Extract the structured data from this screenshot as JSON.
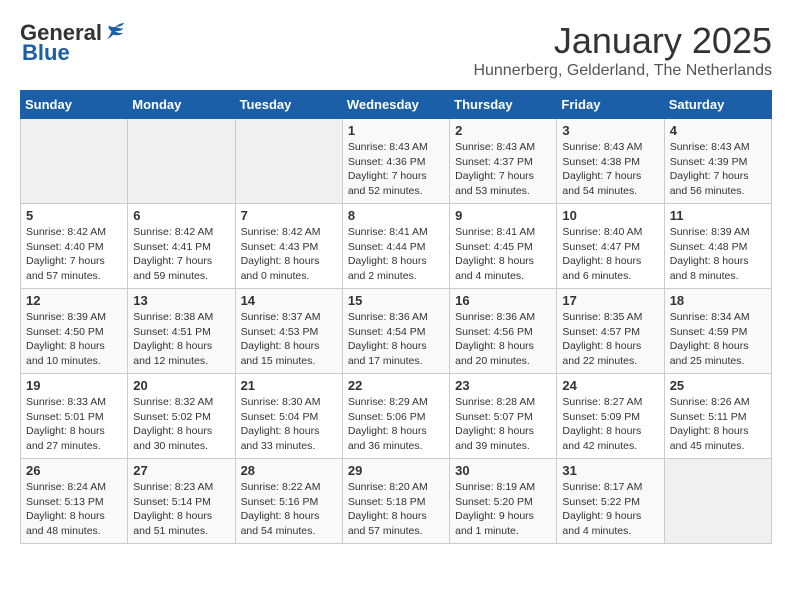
{
  "header": {
    "logo_general": "General",
    "logo_blue": "Blue",
    "month": "January 2025",
    "location": "Hunnerberg, Gelderland, The Netherlands"
  },
  "weekdays": [
    "Sunday",
    "Monday",
    "Tuesday",
    "Wednesday",
    "Thursday",
    "Friday",
    "Saturday"
  ],
  "weeks": [
    [
      {
        "day": "",
        "info": ""
      },
      {
        "day": "",
        "info": ""
      },
      {
        "day": "",
        "info": ""
      },
      {
        "day": "1",
        "info": "Sunrise: 8:43 AM\nSunset: 4:36 PM\nDaylight: 7 hours\nand 52 minutes."
      },
      {
        "day": "2",
        "info": "Sunrise: 8:43 AM\nSunset: 4:37 PM\nDaylight: 7 hours\nand 53 minutes."
      },
      {
        "day": "3",
        "info": "Sunrise: 8:43 AM\nSunset: 4:38 PM\nDaylight: 7 hours\nand 54 minutes."
      },
      {
        "day": "4",
        "info": "Sunrise: 8:43 AM\nSunset: 4:39 PM\nDaylight: 7 hours\nand 56 minutes."
      }
    ],
    [
      {
        "day": "5",
        "info": "Sunrise: 8:42 AM\nSunset: 4:40 PM\nDaylight: 7 hours\nand 57 minutes."
      },
      {
        "day": "6",
        "info": "Sunrise: 8:42 AM\nSunset: 4:41 PM\nDaylight: 7 hours\nand 59 minutes."
      },
      {
        "day": "7",
        "info": "Sunrise: 8:42 AM\nSunset: 4:43 PM\nDaylight: 8 hours\nand 0 minutes."
      },
      {
        "day": "8",
        "info": "Sunrise: 8:41 AM\nSunset: 4:44 PM\nDaylight: 8 hours\nand 2 minutes."
      },
      {
        "day": "9",
        "info": "Sunrise: 8:41 AM\nSunset: 4:45 PM\nDaylight: 8 hours\nand 4 minutes."
      },
      {
        "day": "10",
        "info": "Sunrise: 8:40 AM\nSunset: 4:47 PM\nDaylight: 8 hours\nand 6 minutes."
      },
      {
        "day": "11",
        "info": "Sunrise: 8:39 AM\nSunset: 4:48 PM\nDaylight: 8 hours\nand 8 minutes."
      }
    ],
    [
      {
        "day": "12",
        "info": "Sunrise: 8:39 AM\nSunset: 4:50 PM\nDaylight: 8 hours\nand 10 minutes."
      },
      {
        "day": "13",
        "info": "Sunrise: 8:38 AM\nSunset: 4:51 PM\nDaylight: 8 hours\nand 12 minutes."
      },
      {
        "day": "14",
        "info": "Sunrise: 8:37 AM\nSunset: 4:53 PM\nDaylight: 8 hours\nand 15 minutes."
      },
      {
        "day": "15",
        "info": "Sunrise: 8:36 AM\nSunset: 4:54 PM\nDaylight: 8 hours\nand 17 minutes."
      },
      {
        "day": "16",
        "info": "Sunrise: 8:36 AM\nSunset: 4:56 PM\nDaylight: 8 hours\nand 20 minutes."
      },
      {
        "day": "17",
        "info": "Sunrise: 8:35 AM\nSunset: 4:57 PM\nDaylight: 8 hours\nand 22 minutes."
      },
      {
        "day": "18",
        "info": "Sunrise: 8:34 AM\nSunset: 4:59 PM\nDaylight: 8 hours\nand 25 minutes."
      }
    ],
    [
      {
        "day": "19",
        "info": "Sunrise: 8:33 AM\nSunset: 5:01 PM\nDaylight: 8 hours\nand 27 minutes."
      },
      {
        "day": "20",
        "info": "Sunrise: 8:32 AM\nSunset: 5:02 PM\nDaylight: 8 hours\nand 30 minutes."
      },
      {
        "day": "21",
        "info": "Sunrise: 8:30 AM\nSunset: 5:04 PM\nDaylight: 8 hours\nand 33 minutes."
      },
      {
        "day": "22",
        "info": "Sunrise: 8:29 AM\nSunset: 5:06 PM\nDaylight: 8 hours\nand 36 minutes."
      },
      {
        "day": "23",
        "info": "Sunrise: 8:28 AM\nSunset: 5:07 PM\nDaylight: 8 hours\nand 39 minutes."
      },
      {
        "day": "24",
        "info": "Sunrise: 8:27 AM\nSunset: 5:09 PM\nDaylight: 8 hours\nand 42 minutes."
      },
      {
        "day": "25",
        "info": "Sunrise: 8:26 AM\nSunset: 5:11 PM\nDaylight: 8 hours\nand 45 minutes."
      }
    ],
    [
      {
        "day": "26",
        "info": "Sunrise: 8:24 AM\nSunset: 5:13 PM\nDaylight: 8 hours\nand 48 minutes."
      },
      {
        "day": "27",
        "info": "Sunrise: 8:23 AM\nSunset: 5:14 PM\nDaylight: 8 hours\nand 51 minutes."
      },
      {
        "day": "28",
        "info": "Sunrise: 8:22 AM\nSunset: 5:16 PM\nDaylight: 8 hours\nand 54 minutes."
      },
      {
        "day": "29",
        "info": "Sunrise: 8:20 AM\nSunset: 5:18 PM\nDaylight: 8 hours\nand 57 minutes."
      },
      {
        "day": "30",
        "info": "Sunrise: 8:19 AM\nSunset: 5:20 PM\nDaylight: 9 hours\nand 1 minute."
      },
      {
        "day": "31",
        "info": "Sunrise: 8:17 AM\nSunset: 5:22 PM\nDaylight: 9 hours\nand 4 minutes."
      },
      {
        "day": "",
        "info": ""
      }
    ]
  ]
}
